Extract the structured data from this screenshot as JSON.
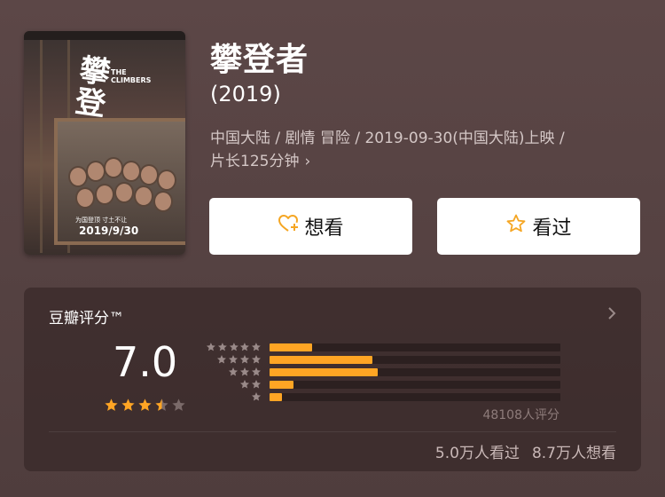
{
  "movie": {
    "title": "攀登者",
    "year": "(2019)",
    "meta_line1": "中国大陆 / 剧情 冒险 / 2019-09-30(中国大陆)上映 /",
    "meta_line2": "片长125分钟",
    "poster": {
      "title_cn": "攀登者",
      "title_en_1": "THE",
      "title_en_2": "CLIMBERS",
      "tagline": "为国登顶 寸土不让",
      "date": "2019/9/30"
    }
  },
  "actions": {
    "want_label": "想看",
    "seen_label": "看过"
  },
  "rating": {
    "label": "豆瓣评分™",
    "score": "7.0",
    "score_stars": 3.5,
    "distribution": [
      {
        "stars": 5,
        "fraction": 0.145
      },
      {
        "stars": 4,
        "fraction": 0.354
      },
      {
        "stars": 3,
        "fraction": 0.372
      },
      {
        "stars": 2,
        "fraction": 0.082
      },
      {
        "stars": 1,
        "fraction": 0.043
      }
    ],
    "count": "48108人评分",
    "watched": "5.0万人看过",
    "wanted": "8.7万人想看"
  },
  "colors": {
    "accent": "#ffa524",
    "background": "#574343",
    "card": "#3f2c2c"
  },
  "icons": {
    "want": "heart-plus-icon",
    "seen": "star-outline-icon",
    "more": "chevron-right-icon"
  }
}
